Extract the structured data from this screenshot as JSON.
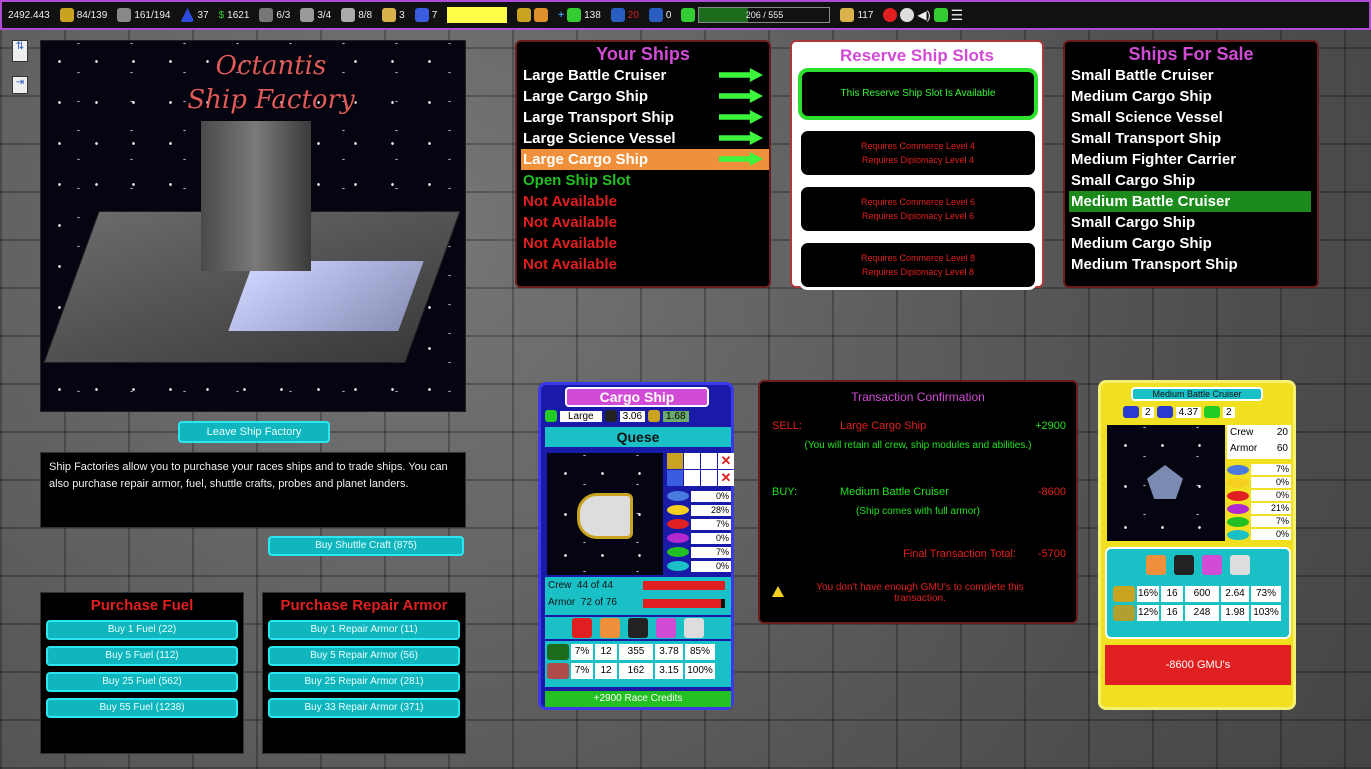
{
  "topbar": {
    "credits": "2492.443",
    "crew": "84/139",
    "ships_stat": "161/194",
    "stat_blue": "37",
    "money": "1621",
    "stat_a": "6/3",
    "stat_b": "3/4",
    "stat_c": "8/8",
    "stat_d": "3",
    "stat_e": "7",
    "pop": "138",
    "stat_red": "20",
    "stat_zero": "0",
    "progress_text": "206 / 555",
    "progress_value": 0.371,
    "stat_last": "117"
  },
  "factory": {
    "title_line1": "Octantis",
    "title_line2": "Ship Factory",
    "leave_button": "Leave Ship Factory",
    "description": "Ship Factories allow you to purchase your races ships and to trade ships. You can also purchase repair armor, fuel, shuttle crafts, probes and planet landers.",
    "shuttle_button": "Buy Shuttle Craft (875)"
  },
  "fuel": {
    "title": "Purchase Fuel",
    "buttons": [
      "Buy 1 Fuel (22)",
      "Buy 5 Fuel (112)",
      "Buy 25 Fuel (562)",
      "Buy 55 Fuel (1238)"
    ]
  },
  "armor": {
    "title": "Purchase Repair Armor",
    "buttons": [
      "Buy 1 Repair Armor (11)",
      "Buy 5 Repair Armor (56)",
      "Buy 25 Repair Armor (281)",
      "Buy 33 Repair Armor (371)"
    ]
  },
  "your_ships": {
    "title": "Your Ships",
    "items": [
      {
        "label": "Large Battle Cruiser",
        "state": "owned"
      },
      {
        "label": "Large Cargo Ship",
        "state": "owned"
      },
      {
        "label": "Large Transport Ship",
        "state": "owned"
      },
      {
        "label": "Large Science Vessel",
        "state": "owned"
      },
      {
        "label": "Large Cargo Ship",
        "state": "selected"
      },
      {
        "label": "Open Ship Slot",
        "state": "open"
      },
      {
        "label": "Not Available",
        "state": "na"
      },
      {
        "label": "Not Available",
        "state": "na"
      },
      {
        "label": "Not Available",
        "state": "na"
      },
      {
        "label": "Not Available",
        "state": "na"
      }
    ]
  },
  "reserve": {
    "title": "Reserve Ship Slots",
    "available": "This Reserve Ship Slot Is Available",
    "slots": [
      {
        "line1": "Requires Commerce Level 4",
        "line2": "Requires Diplomacy Level 4"
      },
      {
        "line1": "Requires Commerce Level 6",
        "line2": "Requires Diplomacy Level 6"
      },
      {
        "line1": "Requires Commerce Level 8",
        "line2": "Requires Diplomacy Level 8"
      }
    ]
  },
  "for_sale": {
    "title": "Ships For Sale",
    "items": [
      "Small Battle Cruiser",
      "Medium Cargo Ship",
      "Small Science Vessel",
      "Small Transport Ship",
      "Medium Fighter Carrier",
      "Small Cargo Ship",
      "Medium Battle Cruiser",
      "Small Cargo Ship",
      "Medium Cargo Ship",
      "Medium Transport Ship"
    ],
    "selected_index": 6
  },
  "cargo_card": {
    "title": "Cargo Ship",
    "size": "Large",
    "stat1": "3.06",
    "stat2": "1.68",
    "name": "Quese",
    "pcts": [
      "0%",
      "28%",
      "7%",
      "0%",
      "7%",
      "0%"
    ],
    "crew_label": "Crew",
    "crew_value": "44 of 44",
    "armor_label": "Armor",
    "armor_value": "72 of 76",
    "crew_fill": 1.0,
    "armor_fill": 0.947,
    "weapons": [
      [
        "7%",
        "12",
        "355",
        "3.78",
        "85%"
      ],
      [
        "7%",
        "12",
        "162",
        "3.15",
        "100%"
      ]
    ],
    "credits": "+2900 Race Credits"
  },
  "transaction": {
    "title": "Transaction Confirmation",
    "sell_label": "SELL:",
    "sell_ship": "Large Cargo Ship",
    "sell_amount": "+2900",
    "sell_note": "(You will retain all crew, ship modules and abilities.)",
    "buy_label": "BUY:",
    "buy_ship": "Medium Battle Cruiser",
    "buy_amount": "-8600",
    "buy_note": "(Ship comes with full armor)",
    "total_label": "Final Transaction Total:",
    "total_amount": "-5700",
    "warning": "You don't have enough GMU's to complete this transaction."
  },
  "mbc_card": {
    "title": "Medium Battle Cruiser",
    "v1": "2",
    "v2": "4.37",
    "v3": "2",
    "crew_label": "Crew",
    "crew_value": "20",
    "armor_label": "Armor",
    "armor_value": "60",
    "pcts": [
      "7%",
      "0%",
      "0%",
      "21%",
      "7%",
      "0%"
    ],
    "weapons": [
      [
        "16%",
        "16",
        "600",
        "2.64",
        "73%"
      ],
      [
        "12%",
        "16",
        "248",
        "1.98",
        "103%"
      ]
    ],
    "cost": "-8600 GMU's"
  },
  "colors": {
    "accent": "#d24bd6",
    "green": "#22c022",
    "red": "#e02020",
    "cyan": "#0fb6be",
    "orange": "#f0903a"
  }
}
